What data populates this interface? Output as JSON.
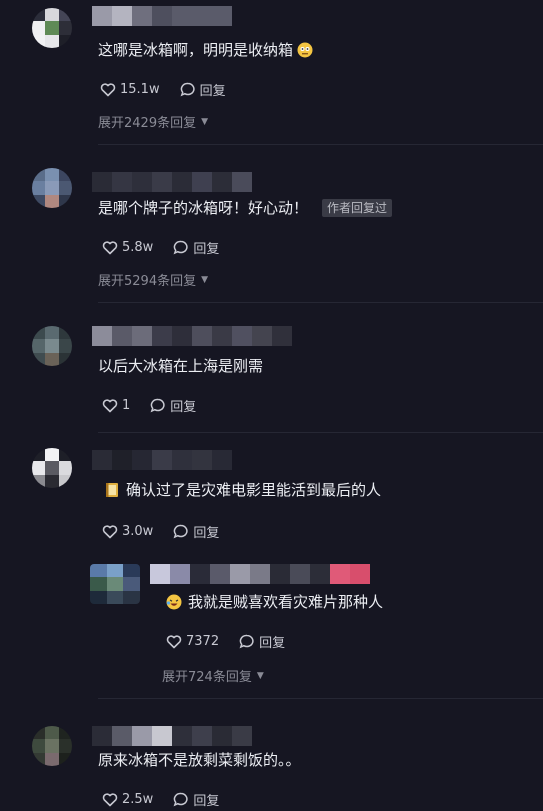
{
  "comments": [
    {
      "text": "这哪是冰箱啊，明明是收纳箱",
      "likes": "15.1w",
      "reply": "回复",
      "expand": "展开2429条回复"
    },
    {
      "text": "是哪个牌子的冰箱呀！好心动！",
      "author_tag": "作者回复过",
      "likes": "5.8w",
      "reply": "回复",
      "expand": "展开5294条回复"
    },
    {
      "text": "以后大冰箱在上海是刚需",
      "likes": "1",
      "reply": "回复"
    },
    {
      "text": "确认过了是灾难电影里能活到最后的人",
      "likes": "3.0w",
      "reply": "回复"
    },
    {
      "text": "我就是贼喜欢看灾难片那种人",
      "likes": "7372",
      "reply": "回复",
      "expand": "展开724条回复"
    },
    {
      "text": "原来冰箱不是放剩菜剩饭的。。",
      "likes": "2.5w",
      "reply": "回复"
    }
  ],
  "icons": {
    "like": "heart-outline-icon",
    "reply": "speech-bubble-icon",
    "expand": "caret-down-icon"
  }
}
